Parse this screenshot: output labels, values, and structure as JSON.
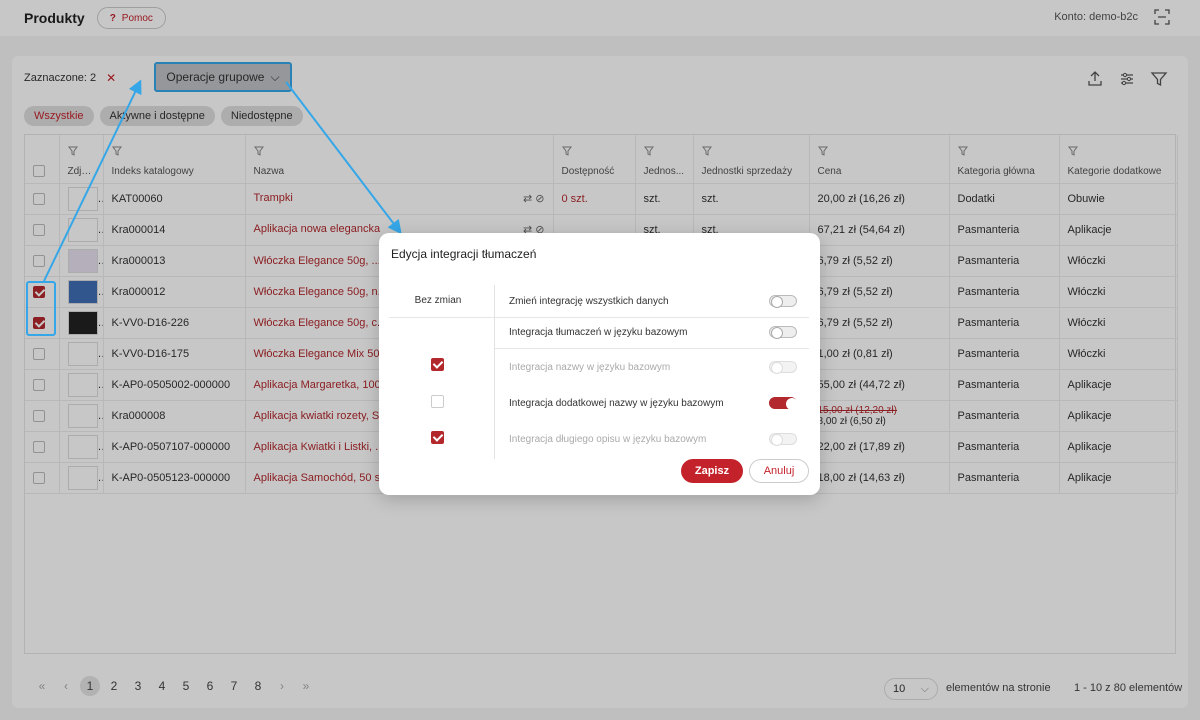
{
  "header": {
    "title": "Produkty",
    "help_label": "Pomoc",
    "help_glyph": "?",
    "account": "Konto: demo-b2c"
  },
  "toolbar": {
    "selected_label": "Zaznaczone: 2",
    "group_ops_label": "Operacje grupowe"
  },
  "chips": [
    "Wszystkie",
    "Aktywne i dostępne",
    "Niedostępne"
  ],
  "table": {
    "columns": [
      "Zdję...",
      "Indeks katalogowy",
      "Nazwa",
      "Dostępność",
      "Jednos...",
      "Jednostki sprzedaży",
      "Cena",
      "Kategoria główna",
      "Kategorie dodatkowe"
    ],
    "rows": [
      {
        "checked": false,
        "index": "KAT00060",
        "name": "Trampki",
        "availability": "0 szt.",
        "unit": "szt.",
        "sale_unit": "szt.",
        "price": "20,00 zł (16,26 zł)",
        "price_old": "",
        "main_cat": "Dodatki",
        "extra_cat": "Obuwie",
        "has_icons": true
      },
      {
        "checked": false,
        "index": "Kra000014",
        "name": "Aplikacja nowa elegancka",
        "availability": "",
        "unit": "szt.",
        "sale_unit": "szt.",
        "price": "67,21 zł (54,64 zł)",
        "price_old": "",
        "main_cat": "Pasmanteria",
        "extra_cat": "Aplikacje",
        "has_icons": true
      },
      {
        "checked": false,
        "index": "Kra000013",
        "name": "Włóczka Elegance 50g, ...",
        "availability": "",
        "unit": "",
        "sale_unit": "",
        "price": "6,79 zł (5,52 zł)",
        "price_old": "",
        "main_cat": "Pasmanteria",
        "extra_cat": "Włóczki",
        "has_icons": false
      },
      {
        "checked": true,
        "index": "Kra000012",
        "name": "Włóczka Elegance 50g, n...",
        "availability": "",
        "unit": "",
        "sale_unit": "",
        "price": "6,79 zł (5,52 zł)",
        "price_old": "",
        "main_cat": "Pasmanteria",
        "extra_cat": "Włóczki",
        "has_icons": false
      },
      {
        "checked": true,
        "index": "K-VV0-D16-226",
        "name": "Włóczka Elegance 50g, c...",
        "availability": "",
        "unit": "",
        "sale_unit": "",
        "price": "6,79 zł (5,52 zł)",
        "price_old": "",
        "main_cat": "Pasmanteria",
        "extra_cat": "Włóczki",
        "has_icons": false
      },
      {
        "checked": false,
        "index": "K-VV0-D16-175",
        "name": "Włóczka Elegance Mix 50...",
        "availability": "",
        "unit": "",
        "sale_unit": "",
        "price": "1,00 zł (0,81 zł)",
        "price_old": "",
        "main_cat": "Pasmanteria",
        "extra_cat": "Włóczki",
        "has_icons": false
      },
      {
        "checked": false,
        "index": "K-AP0-0505002-000000",
        "name": "Aplikacja Margaretka, 100...",
        "availability": "",
        "unit": "",
        "sale_unit": "",
        "price": "55,00 zł (44,72 zł)",
        "price_old": "",
        "main_cat": "Pasmanteria",
        "extra_cat": "Aplikacje",
        "has_icons": false
      },
      {
        "checked": false,
        "index": "Kra000008",
        "name": "Aplikacja kwiatki rozety, S...",
        "availability": "",
        "unit": "",
        "sale_unit": "",
        "price": "8,00 zł (6,50 zł)",
        "price_old": "15,00 zł (12,20 zł)",
        "main_cat": "Pasmanteria",
        "extra_cat": "Aplikacje",
        "has_icons": false
      },
      {
        "checked": false,
        "index": "K-AP0-0507107-000000",
        "name": "Aplikacja Kwiatki i Listki, ...",
        "availability": "",
        "unit": "",
        "sale_unit": "",
        "price": "22,00 zł (17,89 zł)",
        "price_old": "",
        "main_cat": "Pasmanteria",
        "extra_cat": "Aplikacje",
        "has_icons": false
      },
      {
        "checked": false,
        "index": "K-AP0-0505123-000000",
        "name": "Aplikacja Samochód, 50 s...",
        "availability": "",
        "unit": "",
        "sale_unit": "",
        "price": "18,00 zł (14,63 zł)",
        "price_old": "",
        "main_cat": "Pasmanteria",
        "extra_cat": "Aplikacje",
        "has_icons": false
      }
    ]
  },
  "pagination": {
    "pages": [
      "1",
      "2",
      "3",
      "4",
      "5",
      "6",
      "7",
      "8"
    ],
    "current": "1",
    "first": "«",
    "prev": "‹",
    "next": "›",
    "last": "»",
    "per_page": "10",
    "per_page_label": "elementów na stronie",
    "range_label": "1 - 10 z 80 elementów"
  },
  "modal": {
    "title": "Edycja integracji tłumaczeń",
    "col_head": "Bez zmian",
    "rows": [
      {
        "label": "Zmień integrację wszystkich danych",
        "toggle": "off",
        "disabled": false
      },
      {
        "label": "Integracja tłumaczeń w języku bazowym",
        "toggle": "off",
        "disabled": false
      },
      {
        "label": "Integracja nazwy w języku bazowym",
        "toggle": "off",
        "disabled": true
      },
      {
        "label": "Integracja dodatkowej nazwy w języku bazowym",
        "toggle": "on",
        "disabled": false
      },
      {
        "label": "Integracja długiego opisu w języku bazowym",
        "toggle": "off",
        "disabled": true
      }
    ],
    "save_label": "Zapisz",
    "cancel_label": "Anuluj"
  },
  "colors": {
    "brand": "#c4222b",
    "highlight": "#35a7e8"
  }
}
